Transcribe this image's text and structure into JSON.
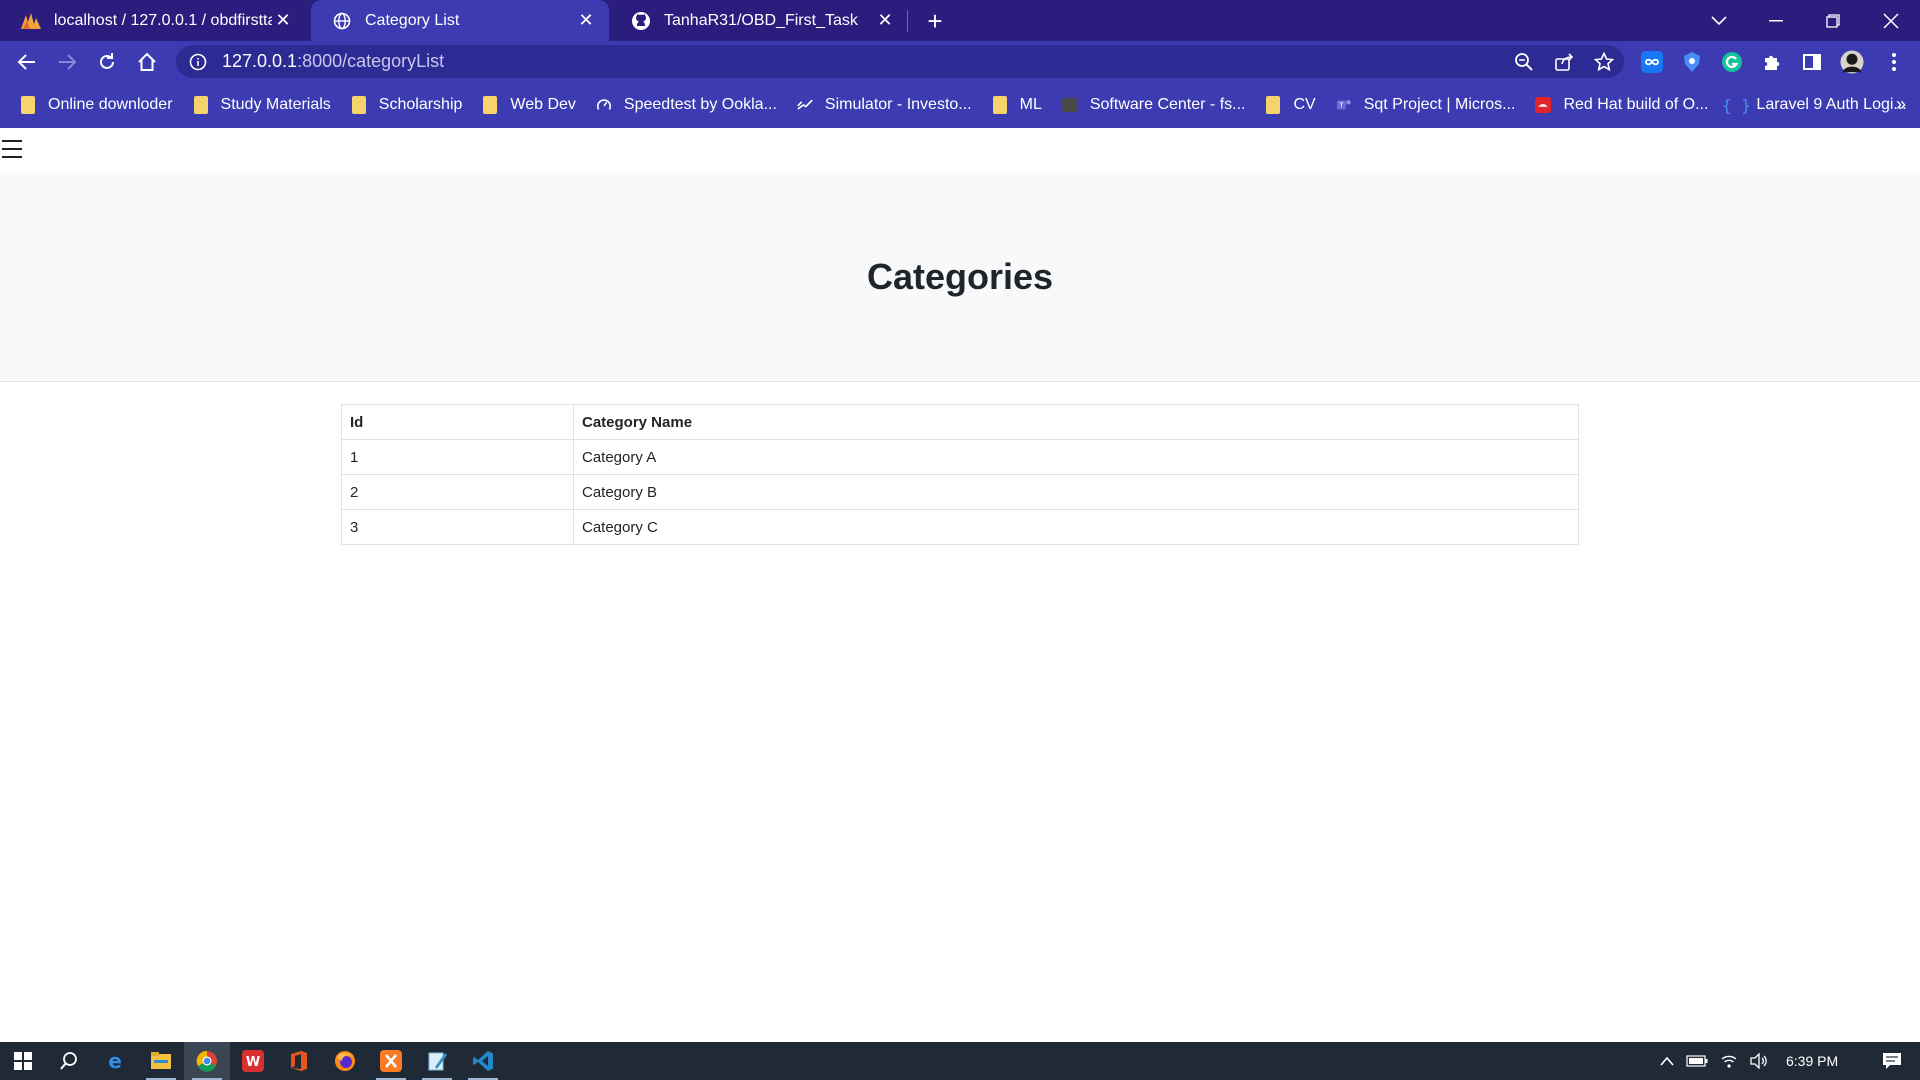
{
  "browser": {
    "tabs": [
      {
        "title": "localhost / 127.0.0.1 / obdfirsttas",
        "icon": "phpmyadmin-icon",
        "active": false
      },
      {
        "title": "Category List",
        "icon": "globe-icon",
        "active": true
      },
      {
        "title": "TanhaR31/OBD_First_Task",
        "icon": "github-icon",
        "active": false
      }
    ],
    "url_host": "127.0.0.1",
    "url_rest": ":8000/categoryList",
    "bookmarks": [
      {
        "label": "Online downloder",
        "icon": "folder-icon"
      },
      {
        "label": "Study Materials",
        "icon": "folder-icon"
      },
      {
        "label": "Scholarship",
        "icon": "folder-icon"
      },
      {
        "label": "Web Dev",
        "icon": "folder-icon"
      },
      {
        "label": "Speedtest by Ookla...",
        "icon": "speedometer-icon"
      },
      {
        "label": "Simulator - Investo...",
        "icon": "investopedia-icon"
      },
      {
        "label": "ML",
        "icon": "folder-icon"
      },
      {
        "label": "Software Center - fs...",
        "icon": "folder-dark-icon"
      },
      {
        "label": "CV",
        "icon": "folder-icon"
      },
      {
        "label": "Sqt Project | Micros...",
        "icon": "teams-icon"
      },
      {
        "label": "Red Hat build of O...",
        "icon": "redhat-icon"
      },
      {
        "label": "Laravel 9 Auth Logi...",
        "icon": "braces-icon"
      }
    ],
    "more_bookmarks": "»"
  },
  "page": {
    "heading": "Categories",
    "table": {
      "headers": [
        "Id",
        "Category Name"
      ],
      "rows": [
        [
          "1",
          "Category A"
        ],
        [
          "2",
          "Category B"
        ],
        [
          "3",
          "Category C"
        ]
      ]
    }
  },
  "taskbar": {
    "time": "6:39 PM"
  },
  "colors": {
    "tabstrip": "#2a1d7d",
    "toolbar": "#3c3bb1",
    "hero": "#f8f9fa",
    "taskbar": "#1f2a36"
  }
}
